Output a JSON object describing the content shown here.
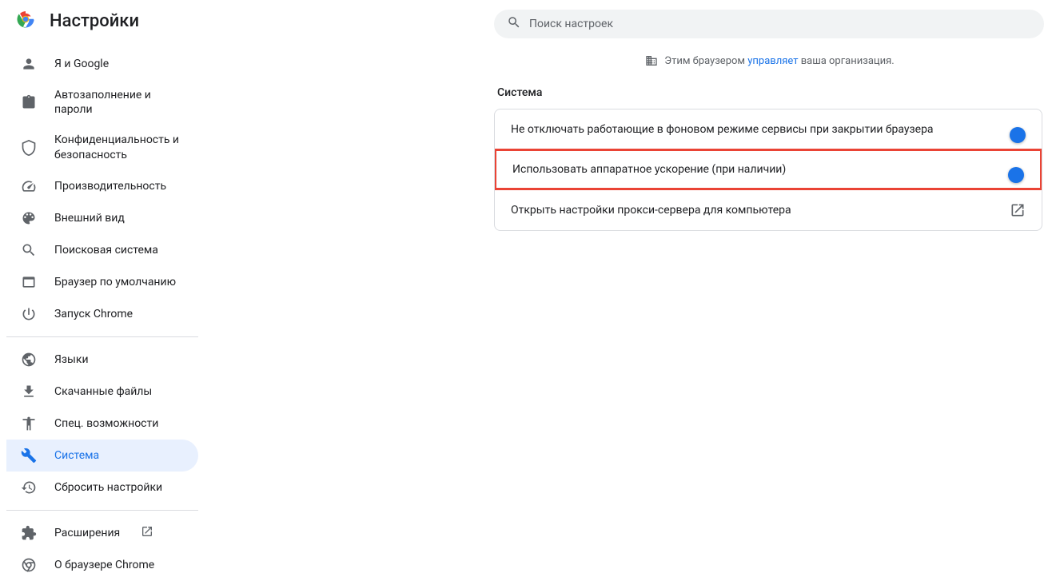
{
  "header": {
    "title": "Настройки"
  },
  "search": {
    "placeholder": "Поиск настроек"
  },
  "managed": {
    "prefix": "Этим браузером ",
    "link": "управляет",
    "suffix": " ваша организация."
  },
  "sidebar": {
    "groups": [
      [
        {
          "icon": "person",
          "label": "Я и Google"
        },
        {
          "icon": "clipboard",
          "label": "Автозаполнение и пароли"
        },
        {
          "icon": "shield",
          "label": "Конфиденциальность и безопасность"
        },
        {
          "icon": "speed",
          "label": "Производительность"
        },
        {
          "icon": "palette",
          "label": "Внешний вид"
        },
        {
          "icon": "search",
          "label": "Поисковая система"
        },
        {
          "icon": "window",
          "label": "Браузер по умолчанию"
        },
        {
          "icon": "power",
          "label": "Запуск Chrome"
        }
      ],
      [
        {
          "icon": "globe",
          "label": "Языки"
        },
        {
          "icon": "download",
          "label": "Скачанные файлы"
        },
        {
          "icon": "accessibility",
          "label": "Спец. возможности"
        },
        {
          "icon": "wrench",
          "label": "Система",
          "active": true
        },
        {
          "icon": "restore",
          "label": "Сбросить настройки"
        }
      ],
      [
        {
          "icon": "extension",
          "label": "Расширения",
          "external": true
        },
        {
          "icon": "chrome",
          "label": "О браузере Chrome"
        }
      ]
    ]
  },
  "section": {
    "title": "Система",
    "rows": [
      {
        "label": "Не отключать работающие в фоновом режиме сервисы при закрытии браузера",
        "toggle": true
      },
      {
        "label": "Использовать аппаратное ускорение (при наличии)",
        "toggle": true,
        "highlighted": true
      },
      {
        "label": "Открыть настройки прокси-сервера для компьютера",
        "launch": true
      }
    ]
  }
}
